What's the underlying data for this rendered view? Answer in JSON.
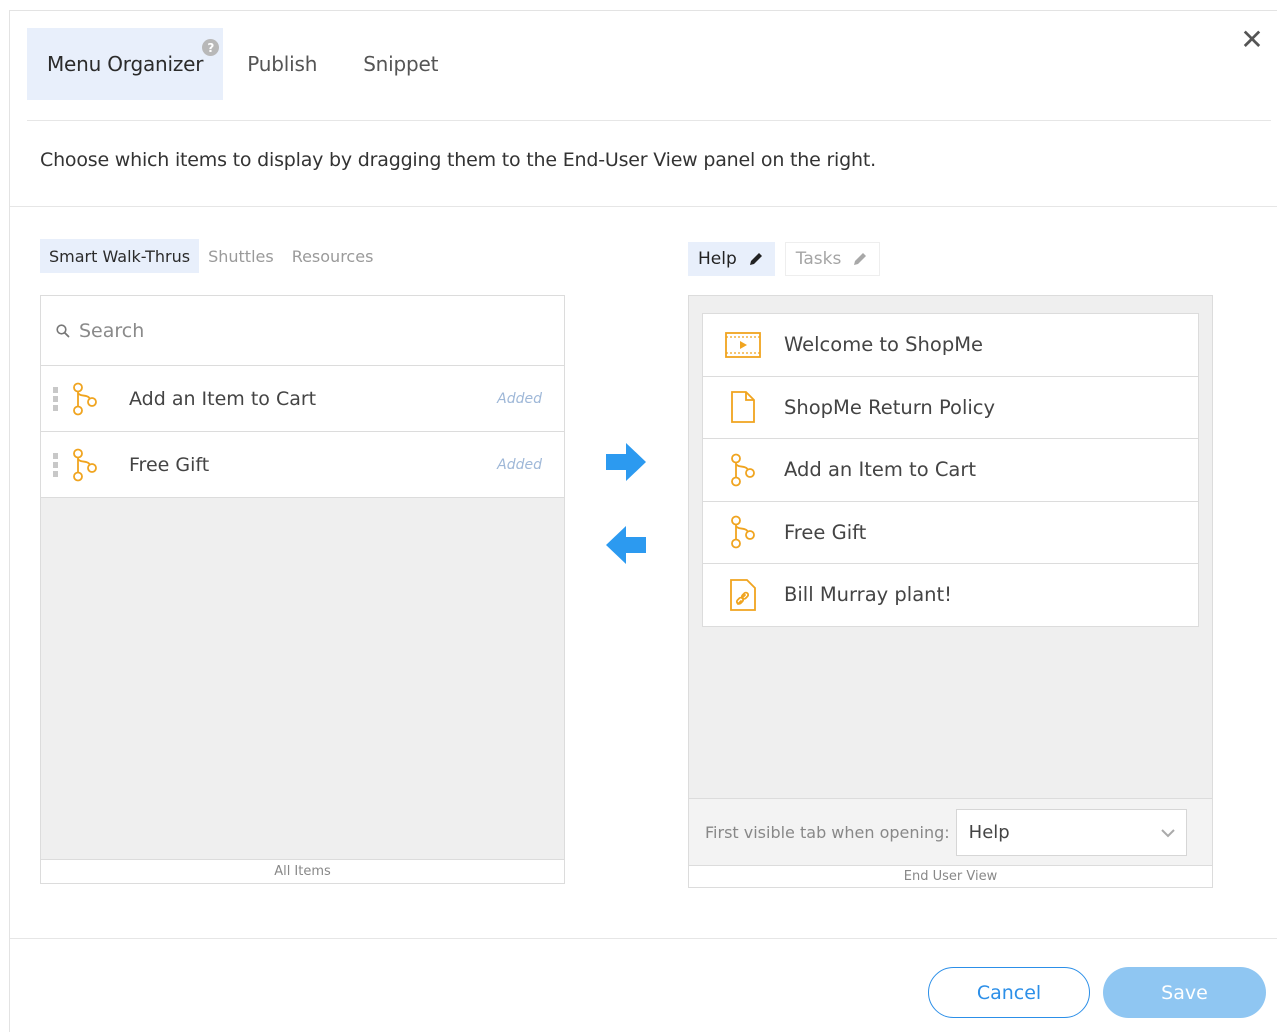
{
  "header": {
    "tabs": [
      {
        "label": "Menu Organizer",
        "active": true,
        "help": "?"
      },
      {
        "label": "Publish",
        "active": false
      },
      {
        "label": "Snippet",
        "active": false
      }
    ],
    "close": "✕"
  },
  "instructions": "Choose which items to display by dragging them to the End-User View panel on the right.",
  "left_panel": {
    "tabs": [
      {
        "label": "Smart Walk-Thrus",
        "active": true
      },
      {
        "label": "Shuttles",
        "active": false
      },
      {
        "label": "Resources",
        "active": false
      }
    ],
    "search_placeholder": "Search",
    "items": [
      {
        "label": "Add an Item to Cart",
        "status": "Added",
        "icon": "walkthru-icon"
      },
      {
        "label": "Free Gift",
        "status": "Added",
        "icon": "walkthru-icon"
      }
    ],
    "footer": "All Items"
  },
  "right_panel": {
    "tabs": [
      {
        "label": "Help",
        "active": true,
        "icon": "pencil-icon"
      },
      {
        "label": "Tasks",
        "active": false,
        "icon": "pencil-icon"
      }
    ],
    "items": [
      {
        "label": "Welcome to ShopMe",
        "icon": "video-icon"
      },
      {
        "label": "ShopMe Return Policy",
        "icon": "document-icon"
      },
      {
        "label": "Add an Item to Cart",
        "icon": "walkthru-icon"
      },
      {
        "label": "Free Gift",
        "icon": "walkthru-icon"
      },
      {
        "label": "Bill Murray plant!",
        "icon": "link-icon"
      }
    ],
    "first_visible_label": "First visible tab when opening:",
    "first_visible_value": "Help",
    "footer": "End User View"
  },
  "buttons": {
    "cancel": "Cancel",
    "save": "Save"
  },
  "colors": {
    "accent": "#2c8fe8",
    "arrow": "#2c9af0",
    "icon_orange": "#f0a41f",
    "tab_active_bg": "#e8effb",
    "save_bg": "#8fc6f2"
  }
}
